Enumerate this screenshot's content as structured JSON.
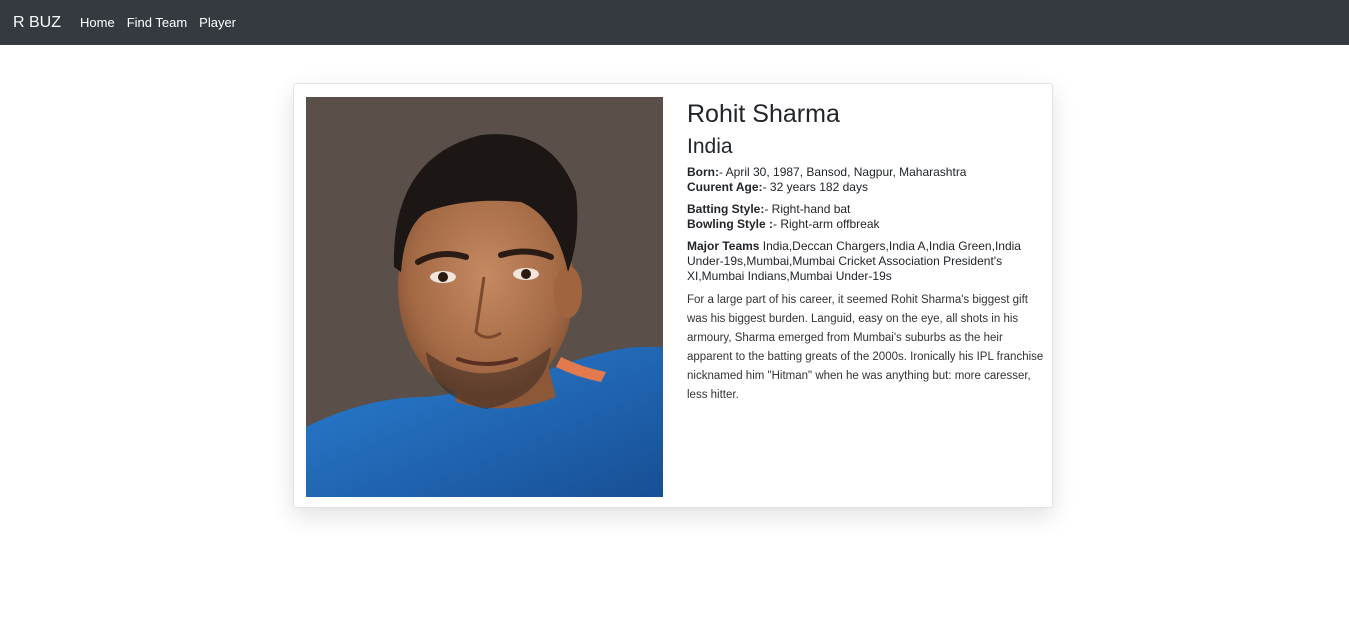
{
  "nav": {
    "brand": "R BUZ",
    "links": [
      {
        "label": "Home"
      },
      {
        "label": "Find Team"
      },
      {
        "label": "Player"
      }
    ]
  },
  "player": {
    "name": "Rohit Sharma",
    "country": "India",
    "born_label": "Born:",
    "born_value": "- April 30, 1987, Bansod, Nagpur, Maharashtra",
    "age_label": "Cuurent Age:",
    "age_value": "- 32 years 182 days",
    "batting_label": "Batting Style:",
    "batting_value": "- Right-hand bat",
    "bowling_label": "Bowling Style :",
    "bowling_value": "- Right-arm offbreak",
    "teams_label": "Major Teams",
    "teams_value": " India,Deccan Chargers,India A,India Green,India Under-19s,Mumbai,Mumbai Cricket Association President's XI,Mumbai Indians,Mumbai Under-19s",
    "bio": "For a large part of his career, it seemed Rohit Sharma's biggest gift was his biggest burden. Languid, easy on the eye, all shots in his armoury, Sharma emerged from Mumbai's suburbs as the heir apparent to the batting greats of the 2000s. Ironically his IPL franchise nicknamed him \"Hitman\" when he was anything but: more caresser, less hitter.",
    "photo_icon": "player-portrait"
  },
  "colors": {
    "navbar_bg": "#343a40",
    "jersey_blue": "#1f6fc0"
  }
}
